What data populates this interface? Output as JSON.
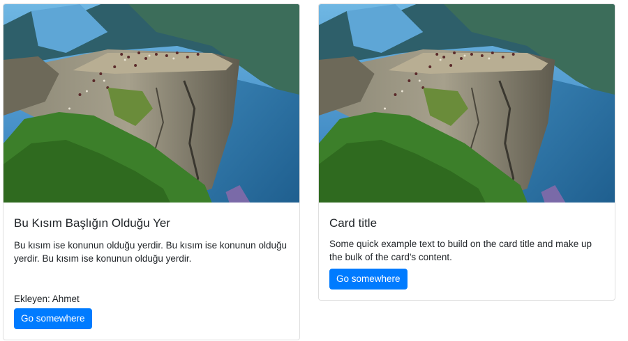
{
  "cards": [
    {
      "image": "cliff-fjord-photo",
      "title": "Bu Kısım Başlığın Olduğu Yer",
      "text": "Bu kısım ise konunun olduğu yerdir. Bu kısım ise konunun olduğu yerdir. Bu kısım ise konunun olduğu yerdir.",
      "author": "Ekleyen: Ahmet",
      "button_label": "Go somewhere"
    },
    {
      "image": "cliff-fjord-photo",
      "title": "Card title",
      "text": "Some quick example text to build on the card title and make up the bulk of the card's content.",
      "button_label": "Go somewhere"
    }
  ],
  "colors": {
    "primary": "#007bff",
    "card_border": "rgba(0,0,0,0.125)",
    "text": "#212529"
  }
}
